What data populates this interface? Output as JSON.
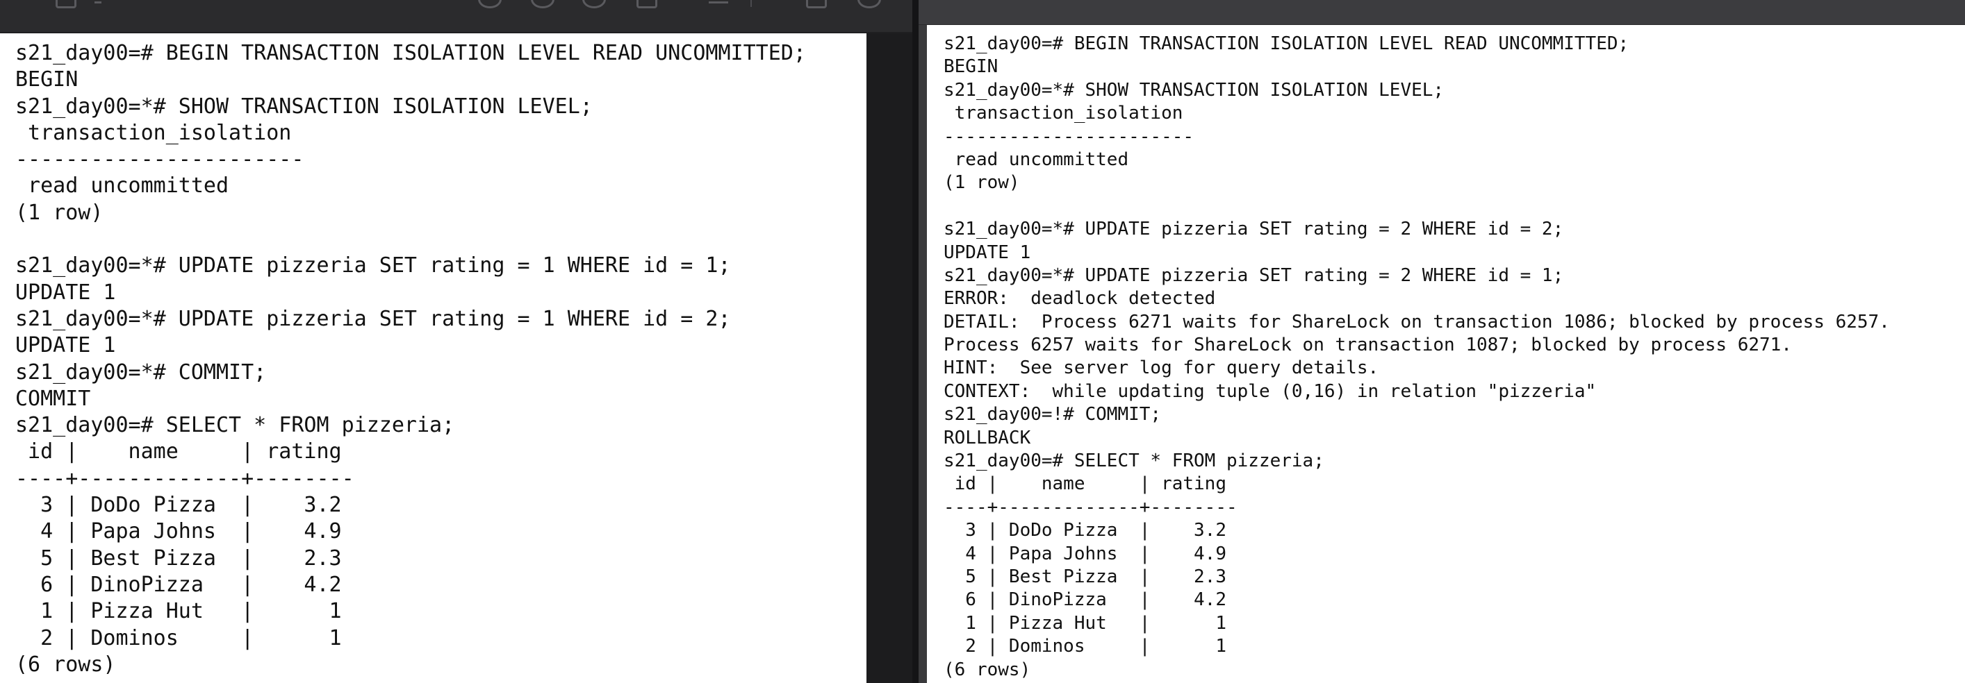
{
  "left_terminal": {
    "lines": [
      "s21_day00=# BEGIN TRANSACTION ISOLATION LEVEL READ UNCOMMITTED;",
      "BEGIN",
      "s21_day00=*# SHOW TRANSACTION ISOLATION LEVEL;",
      " transaction_isolation",
      "-----------------------",
      " read uncommitted",
      "(1 row)",
      "",
      "s21_day00=*# UPDATE pizzeria SET rating = 1 WHERE id = 1;",
      "UPDATE 1",
      "s21_day00=*# UPDATE pizzeria SET rating = 1 WHERE id = 2;",
      "UPDATE 1",
      "s21_day00=*# COMMIT;",
      "COMMIT",
      "s21_day00=# SELECT * FROM pizzeria;",
      " id |    name     | rating",
      "----+-------------+--------",
      "  3 | DoDo Pizza  |    3.2",
      "  4 | Papa Johns  |    4.9",
      "  5 | Best Pizza  |    2.3",
      "  6 | DinoPizza   |    4.2",
      "  1 | Pizza Hut   |      1",
      "  2 | Dominos     |      1",
      "(6 rows)"
    ]
  },
  "right_terminal": {
    "lines": [
      "s21_day00=# BEGIN TRANSACTION ISOLATION LEVEL READ UNCOMMITTED;",
      "BEGIN",
      "s21_day00=*# SHOW TRANSACTION ISOLATION LEVEL;",
      " transaction_isolation",
      "-----------------------",
      " read uncommitted",
      "(1 row)",
      "",
      "s21_day00=*# UPDATE pizzeria SET rating = 2 WHERE id = 2;",
      "UPDATE 1",
      "s21_day00=*# UPDATE pizzeria SET rating = 2 WHERE id = 1;",
      "ERROR:  deadlock detected",
      "DETAIL:  Process 6271 waits for ShareLock on transaction 1086; blocked by process 6257.",
      "Process 6257 waits for ShareLock on transaction 1087; blocked by process 6271.",
      "HINT:  See server log for query details.",
      "CONTEXT:  while updating tuple (0,16) in relation \"pizzeria\"",
      "s21_day00=!# COMMIT;",
      "ROLLBACK",
      "s21_day00=# SELECT * FROM pizzeria;",
      " id |    name     | rating",
      "----+-------------+--------",
      "  3 | DoDo Pizza  |    3.2",
      "  4 | Papa Johns  |    4.9",
      "  5 | Best Pizza  |    2.3",
      "  6 | DinoPizza   |    4.2",
      "  1 | Pizza Hut   |      1",
      "  2 | Dominos     |      1",
      "(6 rows)"
    ]
  },
  "toolbar_icons": [
    "window-icon",
    "chevron-icon",
    "info-icon",
    "zoom-in-icon",
    "zoom-out-icon",
    "share-icon",
    "highlight-icon",
    "copy-icon",
    "markup-icon"
  ],
  "colors": {
    "terminal_bg": "#ffffff",
    "terminal_text": "#111111",
    "chrome_dark": "#1f1f21",
    "titlebar": "#3c3c3f"
  }
}
